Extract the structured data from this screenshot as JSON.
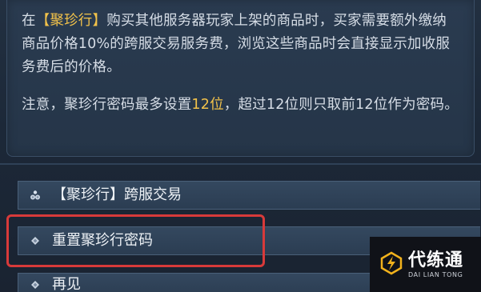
{
  "description": {
    "p1_pre": "在",
    "p1_hl": "【聚珍行】",
    "p1_post": "购买其他服务器玩家上架的商品时，买家需要额外缴纳商品价格10%的跨服交易服务费，浏览这些商品时会直接显示加收服务费后的价格。",
    "p2_pre": "注意，聚珍行密码最多设置",
    "p2_hl": "12位",
    "p2_post": "，超过12位则只取前12位作为密码。"
  },
  "options": [
    {
      "label": "【聚珍行】跨服交易",
      "icon": "coin-bag-icon"
    },
    {
      "label": "重置聚珍行密码",
      "icon": "diamond-bullet-icon"
    },
    {
      "label": "再见",
      "icon": "diamond-bullet-icon"
    }
  ],
  "colors": {
    "highlight": "#f2c24a",
    "annotation_box": "#d83a3a"
  },
  "watermark": {
    "name_cn": "代练通",
    "name_en": "DAI LIAN TONG"
  }
}
